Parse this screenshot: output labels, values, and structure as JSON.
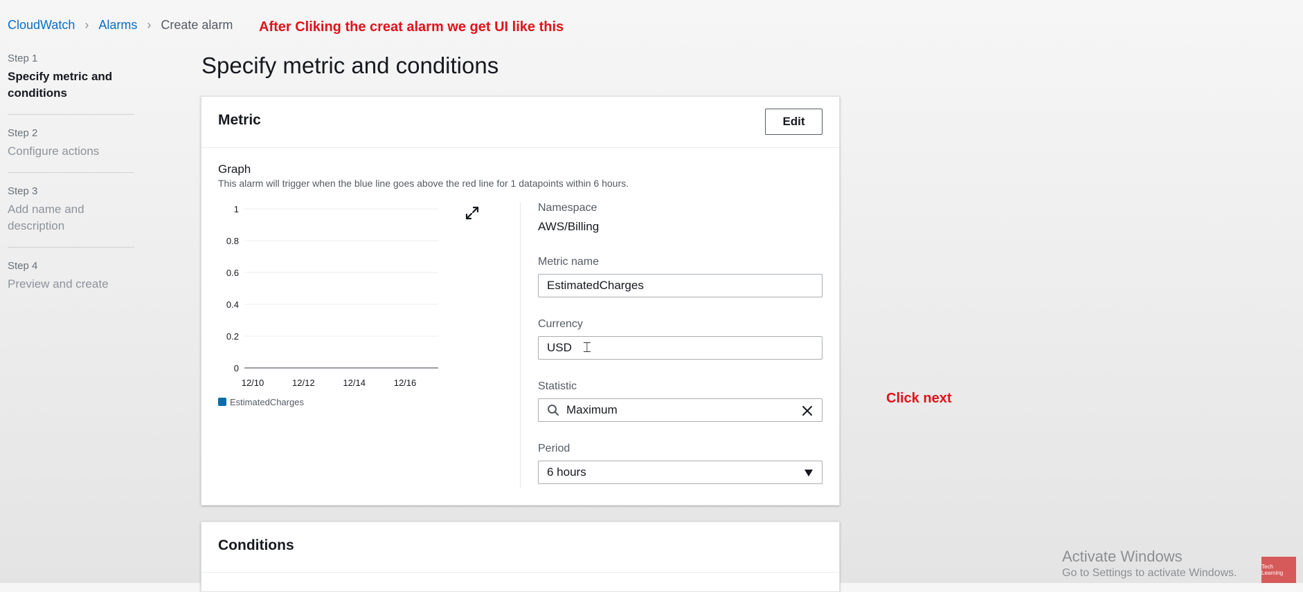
{
  "breadcrumb": {
    "items": [
      "CloudWatch",
      "Alarms",
      "Create alarm"
    ]
  },
  "annotations": {
    "top": "After Cliking the creat alarm we get UI like this",
    "next": "Click next"
  },
  "steps": [
    {
      "num": "Step 1",
      "title": "Specify metric and conditions",
      "active": true
    },
    {
      "num": "Step 2",
      "title": "Configure actions",
      "active": false
    },
    {
      "num": "Step 3",
      "title": "Add name and description",
      "active": false
    },
    {
      "num": "Step 4",
      "title": "Preview and create",
      "active": false
    }
  ],
  "page": {
    "title": "Specify metric and conditions"
  },
  "metric_panel": {
    "title": "Metric",
    "edit_label": "Edit",
    "graph_label": "Graph",
    "graph_desc": "This alarm will trigger when the blue line goes above the red line for 1 datapoints within 6 hours."
  },
  "fields": {
    "namespace": {
      "label": "Namespace",
      "value": "AWS/Billing"
    },
    "metric_name": {
      "label": "Metric name",
      "value": "EstimatedCharges"
    },
    "currency": {
      "label": "Currency",
      "value": "USD"
    },
    "statistic": {
      "label": "Statistic",
      "value": "Maximum"
    },
    "period": {
      "label": "Period",
      "value": "6 hours"
    }
  },
  "conditions_panel": {
    "title": "Conditions"
  },
  "watermark": {
    "title": "Activate Windows",
    "subtitle": "Go to Settings to activate Windows.",
    "logo_text": "Tech Learning"
  },
  "colors": {
    "link": "#0a6ec9",
    "annotation": "#e0121b",
    "series": "#0a6ea6"
  },
  "chart_data": {
    "type": "line",
    "x_ticks": [
      "12/10",
      "12/12",
      "12/14",
      "12/16"
    ],
    "y_ticks": [
      "1",
      "0.8",
      "0.6",
      "0.4",
      "0.2",
      "0"
    ],
    "ylim": [
      0,
      1
    ],
    "legend": [
      "EstimatedCharges"
    ],
    "series": [
      {
        "name": "EstimatedCharges",
        "values": []
      }
    ],
    "grid": true
  }
}
